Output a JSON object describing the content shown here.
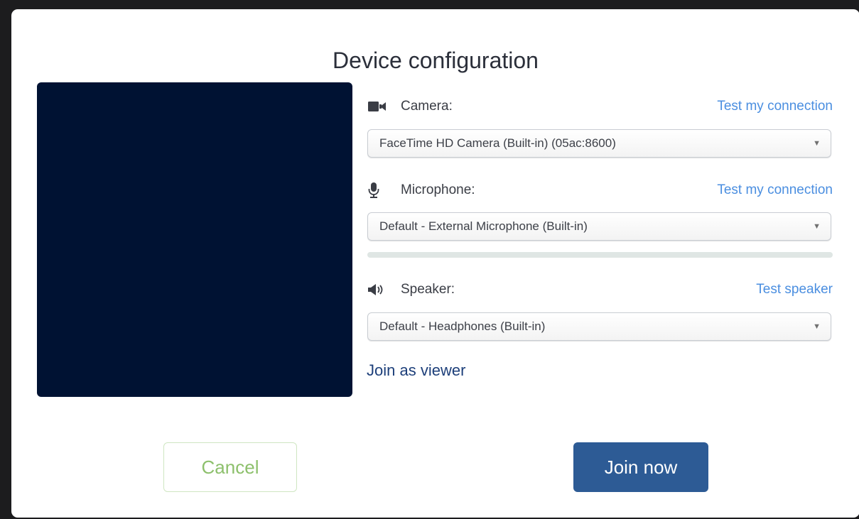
{
  "dialog": {
    "title": "Device configuration"
  },
  "camera": {
    "label": "Camera:",
    "icon": "video-camera-icon",
    "test_link": "Test my connection",
    "selected": "FaceTime HD Camera (Built-in) (05ac:8600)"
  },
  "microphone": {
    "label": "Microphone:",
    "icon": "microphone-icon",
    "test_link": "Test my connection",
    "selected": "Default - External Microphone (Built-in)",
    "level": 0
  },
  "speaker": {
    "label": "Speaker:",
    "icon": "speaker-icon",
    "test_link": "Test speaker",
    "selected": "Default - Headphones (Built-in)"
  },
  "join_as_viewer": "Join as viewer",
  "buttons": {
    "cancel": "Cancel",
    "join": "Join now"
  },
  "colors": {
    "preview_bg": "#001233",
    "link": "#4a8ee0",
    "join_button": "#2d5b95",
    "cancel_text": "#8dc06c"
  }
}
